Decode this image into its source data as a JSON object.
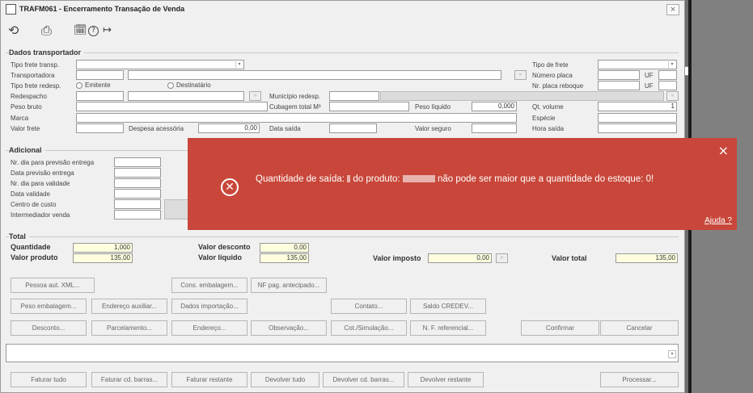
{
  "window": {
    "title": "TRAFM061 - Encerramento Transação de Venda",
    "close": "×"
  },
  "toolbar": {
    "refresh": "⟲",
    "print": "⎙",
    "calendar": "🗓",
    "help": "?",
    "exit": "↦"
  },
  "transportador": {
    "title": "Dados transportador",
    "tipo_frete_transp": "Tipo frete transp.",
    "transportadora": "Transportadora",
    "tipo_frete_redesp": "Tipo frete redesp.",
    "emitente": "Emitente",
    "destinatario": "Destinatário",
    "redespacho": "Redespacho",
    "municipio_redesp": "Município redesp.",
    "peso_bruto": "Peso bruto",
    "cubagem": "Cubagem total M³",
    "peso_liquido": "Peso líquido",
    "peso_liquido_value": "0,000",
    "marca": "Marca",
    "valor_frete": "Valor frete",
    "despesa_acessoria": "Despesa acessória",
    "despesa_acessoria_value": "0,00",
    "data_saida": "Data saída",
    "valor_seguro": "Valor seguro",
    "tipo_de_frete": "Tipo de frete",
    "numero_placa": "Número placa",
    "uf": "UF",
    "nr_placa_reboque": "Nr. placa reboque",
    "qt_volume": "Qt. volume",
    "qt_volume_value": "1",
    "especie": "Espécie",
    "hora_saida": "Hora saída"
  },
  "adicional": {
    "title": "Adicional",
    "nr_dia_previsao": "Nr. dia para previsão entrega",
    "data_previsao": "Data previsão entrega",
    "nr_dia_validade": "Nr. dia para validade",
    "data_validade": "Data validade",
    "centro_custo": "Centro de custo",
    "intermediador": "Intermediador venda"
  },
  "total": {
    "title": "Total",
    "quantidade": "Quantidade",
    "quantidade_value": "1,000",
    "valor_produto": "Valor produto",
    "valor_produto_value": "135,00",
    "valor_desconto": "Valor desconto",
    "valor_desconto_value": "0,00",
    "valor_liquido": "Valor líquido",
    "valor_liquido_value": "135,00",
    "valor_imposto": "Valor imposto",
    "valor_imposto_value": "0,00",
    "valor_total": "Valor total",
    "valor_total_value": "135,00"
  },
  "buttons": {
    "pessoa_aut_xml": "Pessoa aut. XML...",
    "cons_embalagem": "Cons. embalagem...",
    "nf_pag_antecipado": "NF pag. antecipado...",
    "peso_embalagem": "Peso embalagem...",
    "endereco_auxiliar": "Endereço auxiliar...",
    "dados_importacao": "Dados importação...",
    "contato": "Contato...",
    "saldo_credev": "Saldo CREDEV...",
    "desconto": "Desconto...",
    "parcelamento": "Parcelamento...",
    "endereco": "Endereço...",
    "observacao": "Observação...",
    "cot_simulacao": "Cot./Simulação...",
    "nf_referencial": "N. F. referencial...",
    "confirmar": "Confirmar",
    "cancelar": "Cancelar",
    "faturar_tudo": "Faturar tudo",
    "faturar_cd_barras": "Faturar cd. barras...",
    "faturar_restante": "Faturar restante",
    "devolver_tudo": "Devolver tudo",
    "devolver_cd_barras": "Devolver cd. barras...",
    "devolver_restante": "Devolver restante",
    "processar": "Processar..."
  },
  "alert": {
    "close": "×",
    "icon": "✕",
    "msg_part1": "Quantidade de saída: ",
    "msg_part2": " do produto: ",
    "msg_part3": " não pode ser maior que a quantidade do estoque: 0!",
    "help": "Ajuda ?",
    "bg_color": "#c8473a"
  }
}
